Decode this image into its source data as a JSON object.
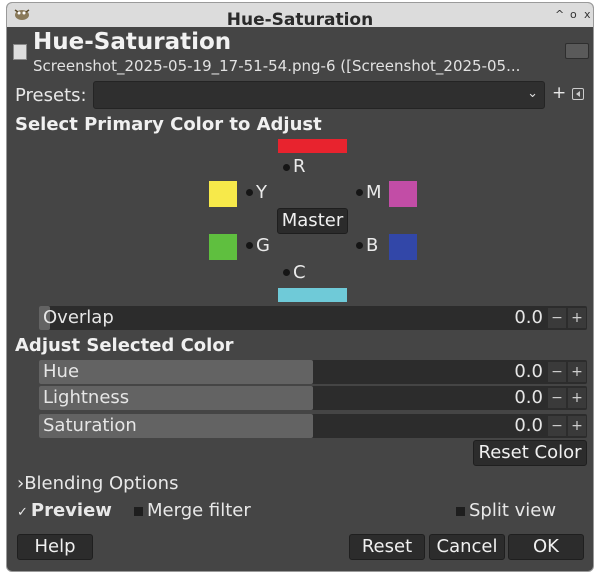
{
  "window": {
    "title": "Hue-Saturation",
    "controls": [
      "^",
      "o",
      "x"
    ]
  },
  "header": {
    "title": "Hue-Saturation",
    "subtitle": "Screenshot_2025-05-19_17-51-54.png-6 ([Screenshot_2025-05..."
  },
  "presets": {
    "label": "Presets:",
    "value": "",
    "add_label": "+"
  },
  "primary": {
    "heading": "Select Primary Color to Adjust",
    "master_label": "Master",
    "colors": [
      {
        "letter": "R",
        "color": "#e8232e"
      },
      {
        "letter": "Y",
        "color": "#f7e94a"
      },
      {
        "letter": "M",
        "color": "#c24da6"
      },
      {
        "letter": "G",
        "color": "#5fbf3f"
      },
      {
        "letter": "B",
        "color": "#3247a8"
      },
      {
        "letter": "C",
        "color": "#6fcad8"
      }
    ]
  },
  "overlap": {
    "label": "Overlap",
    "value": "0.0",
    "fill_fraction": 0.02
  },
  "adjust": {
    "heading": "Adjust Selected Color",
    "sliders": [
      {
        "label": "Hue",
        "value": "0.0",
        "fill_fraction": 0.5
      },
      {
        "label": "Lightness",
        "value": "0.0",
        "fill_fraction": 0.5
      },
      {
        "label": "Saturation",
        "value": "0.0",
        "fill_fraction": 0.5
      }
    ],
    "step_minus": "−",
    "step_plus": "+",
    "reset_color_label": "Reset Color"
  },
  "blending": {
    "label": "Blending Options",
    "expander_glyph": "›"
  },
  "options": {
    "preview_label": "Preview",
    "preview_checked": true,
    "merge_label": "Merge filter",
    "split_label": "Split view"
  },
  "buttons": {
    "help": "Help",
    "reset": "Reset",
    "cancel": "Cancel",
    "ok": "OK"
  }
}
